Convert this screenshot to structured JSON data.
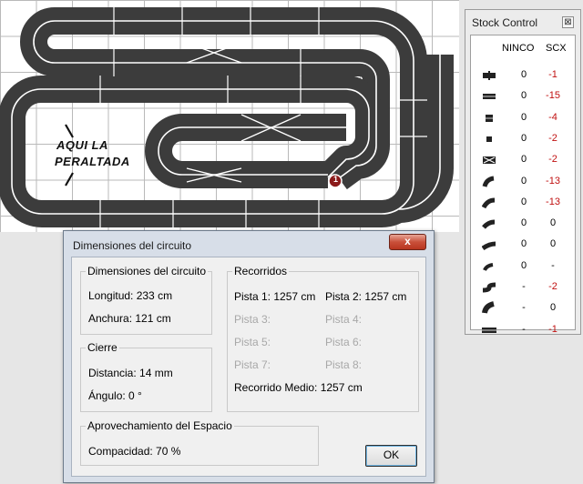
{
  "canvas": {
    "annotation_line1": "AQUI LA",
    "annotation_line2": "PERALTADA",
    "start_marker": "1"
  },
  "stock": {
    "title": "Stock Control",
    "close_glyph": "⊠",
    "col_ninco": "NINCO",
    "col_scx": "SCX",
    "rows": [
      {
        "icon": "straight-cross-piece-icon",
        "ninco": "0",
        "scx": "-1"
      },
      {
        "icon": "straight-piece-icon",
        "ninco": "0",
        "scx": "-15"
      },
      {
        "icon": "short-straight-piece-icon",
        "ninco": "0",
        "scx": "-4"
      },
      {
        "icon": "quarter-straight-piece-icon",
        "ninco": "0",
        "scx": "-2"
      },
      {
        "icon": "crossover-piece-icon",
        "ninco": "0",
        "scx": "-2"
      },
      {
        "icon": "curve-inner-piece-icon",
        "ninco": "0",
        "scx": "-13"
      },
      {
        "icon": "curve-standard-piece-icon",
        "ninco": "0",
        "scx": "-13"
      },
      {
        "icon": "curve-outer-piece-icon",
        "ninco": "0",
        "scx": "0"
      },
      {
        "icon": "curve-wide-piece-icon",
        "ninco": "0",
        "scx": "0"
      },
      {
        "icon": "curve-tight-piece-icon",
        "ninco": "0",
        "scx": "-"
      },
      {
        "icon": "chicane-piece-icon",
        "ninco": "-",
        "scx": "-2"
      },
      {
        "icon": "banked-curve-piece-icon",
        "ninco": "-",
        "scx": "0"
      },
      {
        "icon": "long-straight-piece-icon",
        "ninco": "-",
        "scx": "-1"
      }
    ]
  },
  "dialog": {
    "title": "Dimensiones del circuito",
    "close_glyph": "x",
    "dimensions": {
      "legend": "Dimensiones del circuito",
      "longitud": "Longitud: 233 cm",
      "anchura": "Anchura: 121 cm"
    },
    "cierre": {
      "legend": "Cierre",
      "distancia": "Distancia: 14 mm",
      "angulo": "Ángulo: 0 °"
    },
    "aprovechamiento": {
      "legend": "Aprovechamiento del Espacio",
      "compacidad": "Compacidad: 70 %"
    },
    "recorridos": {
      "legend": "Recorridos",
      "pista1": "Pista 1: 1257 cm",
      "pista2": "Pista 2: 1257 cm",
      "pista3": "Pista 3:",
      "pista4": "Pista 4:",
      "pista5": "Pista 5:",
      "pista6": "Pista 6:",
      "pista7": "Pista 7:",
      "pista8": "Pista 8:",
      "medio": "Recorrido Medio: 1257 cm"
    },
    "ok_label": "OK"
  }
}
